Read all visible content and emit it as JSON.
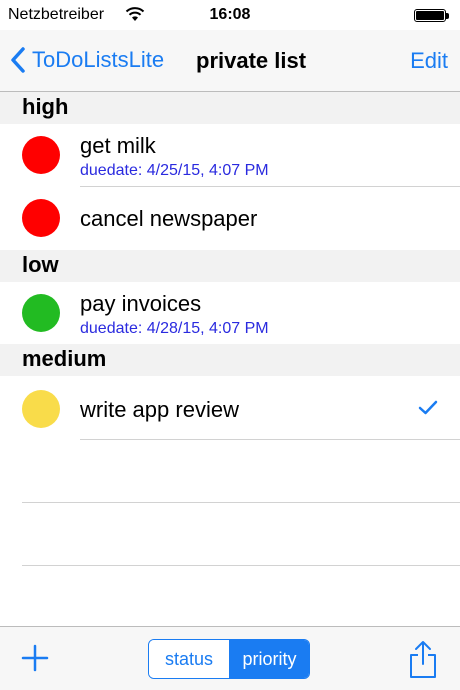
{
  "status_bar": {
    "carrier": "Netzbetreiber",
    "time": "16:08",
    "wifi_icon": "wifi-icon",
    "battery_icon": "battery-icon"
  },
  "nav": {
    "back_label": "ToDoListsLite",
    "title": "private list",
    "edit_label": "Edit"
  },
  "sections": [
    {
      "header": "high",
      "items": [
        {
          "title": "get milk",
          "due": "duedate: 4/25/15, 4:07 PM",
          "color": "#ff0000"
        },
        {
          "title": "cancel newspaper",
          "color": "#ff0000"
        }
      ]
    },
    {
      "header": "low",
      "items": [
        {
          "title": "pay invoices",
          "due": "duedate: 4/28/15, 4:07 PM",
          "color": "#22bb22"
        }
      ]
    },
    {
      "header": "medium",
      "items": [
        {
          "title": "write app review",
          "color": "#f9dc4a",
          "checked": true
        }
      ]
    }
  ],
  "toolbar": {
    "add_icon": "plus-icon",
    "segments": [
      "status",
      "priority"
    ],
    "selected_segment": "priority",
    "share_icon": "share-icon"
  },
  "colors": {
    "accent": "#1a7cf2",
    "due_text": "#2a2adf"
  }
}
